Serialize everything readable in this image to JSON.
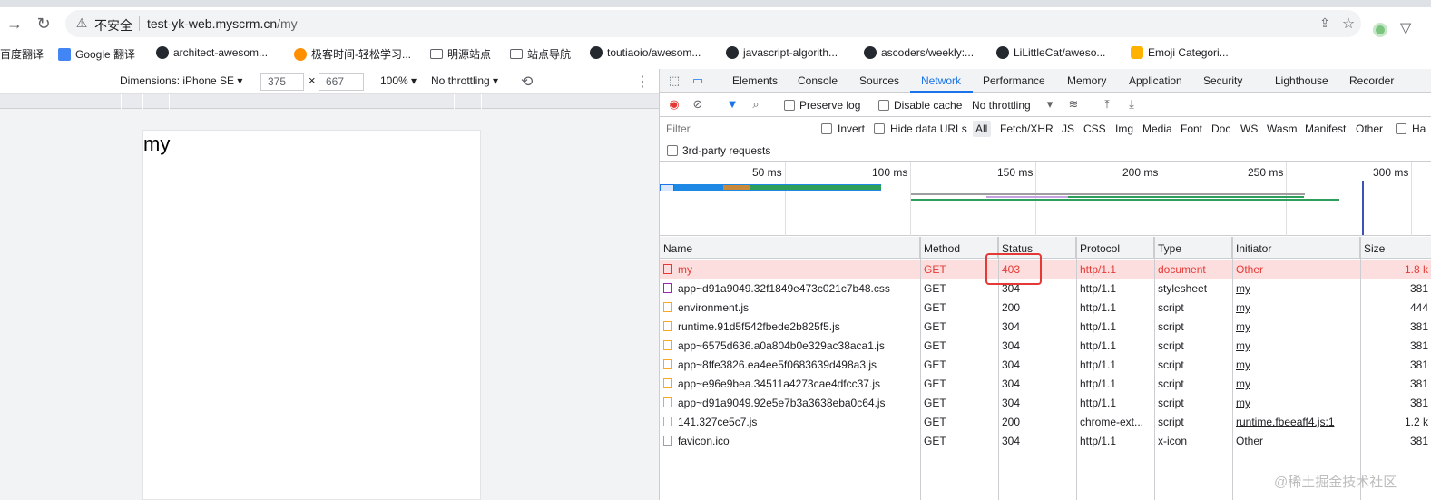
{
  "browser": {
    "insecure_label": "不安全",
    "url_host": "test-yk-web.myscrm.cn",
    "url_path": "/my"
  },
  "bookmarks": [
    {
      "label": "百度翻译",
      "icon": "none"
    },
    {
      "label": "Google 翻译",
      "icon": "google-translate-icon"
    },
    {
      "label": "architect-awesom...",
      "icon": "github-icon"
    },
    {
      "label": "极客时间-轻松学习...",
      "icon": "geektime-icon"
    },
    {
      "label": "明源站点",
      "icon": "folder-icon"
    },
    {
      "label": "站点导航",
      "icon": "folder-icon"
    },
    {
      "label": "toutiaoio/awesom...",
      "icon": "github-icon"
    },
    {
      "label": "javascript-algorith...",
      "icon": "github-icon"
    },
    {
      "label": "ascoders/weekly:...",
      "icon": "github-icon"
    },
    {
      "label": "LiLittleCat/aweso...",
      "icon": "github-icon"
    },
    {
      "label": "Emoji Categori...",
      "icon": "emoji-icon"
    }
  ],
  "device_toolbar": {
    "dimensions": "Dimensions: iPhone SE ▾",
    "width": "375",
    "x": "×",
    "height": "667",
    "zoom": "100% ▾",
    "throttling": "No throttling ▾"
  },
  "page": {
    "heading": "my"
  },
  "devtools": {
    "tabs": [
      "Elements",
      "Console",
      "Sources",
      "Network",
      "Performance",
      "Memory",
      "Application",
      "Security",
      "Lighthouse",
      "Recorder"
    ],
    "active_tab": "Network",
    "toolbar": {
      "preserve_log": "Preserve log",
      "disable_cache": "Disable cache",
      "throttling": "No throttling"
    },
    "filter": {
      "placeholder": "Filter",
      "invert": "Invert",
      "hide_data_urls": "Hide data URLs",
      "types": [
        "All",
        "Fetch/XHR",
        "JS",
        "CSS",
        "Img",
        "Media",
        "Font",
        "Doc",
        "WS",
        "Wasm",
        "Manifest",
        "Other"
      ],
      "has_blocked": "Ha",
      "third_party": "3rd-party requests"
    },
    "timeline_labels": [
      "50 ms",
      "100 ms",
      "150 ms",
      "200 ms",
      "250 ms",
      "300 ms"
    ],
    "columns": [
      "Name",
      "Method",
      "Status",
      "Protocol",
      "Type",
      "Initiator",
      "Size"
    ],
    "rows": [
      {
        "name": "my",
        "method": "GET",
        "status": "403",
        "protocol": "http/1.1",
        "type": "document",
        "initiator": "Other",
        "size": "1.8 k",
        "icon": "doc"
      },
      {
        "name": "app~d91a9049.32f1849e473c021c7b48.css",
        "method": "GET",
        "status": "304",
        "protocol": "http/1.1",
        "type": "stylesheet",
        "initiator": "my",
        "size": "381",
        "icon": "css"
      },
      {
        "name": "environment.js",
        "method": "GET",
        "status": "200",
        "protocol": "http/1.1",
        "type": "script",
        "initiator": "my",
        "size": "444",
        "icon": "js"
      },
      {
        "name": "runtime.91d5f542fbede2b825f5.js",
        "method": "GET",
        "status": "304",
        "protocol": "http/1.1",
        "type": "script",
        "initiator": "my",
        "size": "381",
        "icon": "js"
      },
      {
        "name": "app~6575d636.a0a804b0e329ac38aca1.js",
        "method": "GET",
        "status": "304",
        "protocol": "http/1.1",
        "type": "script",
        "initiator": "my",
        "size": "381",
        "icon": "js"
      },
      {
        "name": "app~8ffe3826.ea4ee5f0683639d498a3.js",
        "method": "GET",
        "status": "304",
        "protocol": "http/1.1",
        "type": "script",
        "initiator": "my",
        "size": "381",
        "icon": "js"
      },
      {
        "name": "app~e96e9bea.34511a4273cae4dfcc37.js",
        "method": "GET",
        "status": "304",
        "protocol": "http/1.1",
        "type": "script",
        "initiator": "my",
        "size": "381",
        "icon": "js"
      },
      {
        "name": "app~d91a9049.92e5e7b3a3638eba0c64.js",
        "method": "GET",
        "status": "304",
        "protocol": "http/1.1",
        "type": "script",
        "initiator": "my",
        "size": "381",
        "icon": "js"
      },
      {
        "name": "141.327ce5c7.js",
        "method": "GET",
        "status": "200",
        "protocol": "chrome-ext...",
        "type": "script",
        "initiator": "runtime.fbeeaff4.js:1",
        "size": "1.2 k",
        "icon": "js"
      },
      {
        "name": "favicon.ico",
        "method": "GET",
        "status": "304",
        "protocol": "http/1.1",
        "type": "x-icon",
        "initiator": "Other",
        "size": "381",
        "icon": "plain"
      }
    ]
  },
  "watermark": "@稀土掘金技术社区"
}
